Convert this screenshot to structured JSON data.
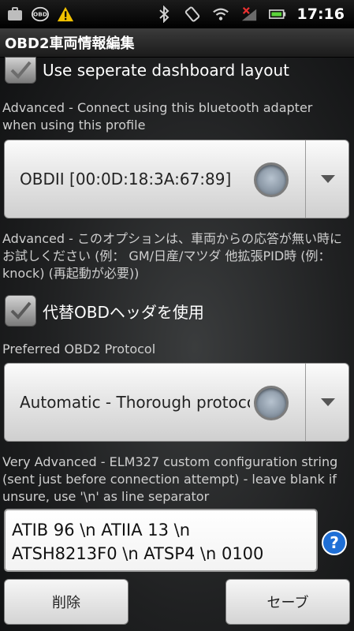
{
  "status_bar": {
    "icons": [
      "briefcase-icon",
      "obd-icon",
      "warning-icon",
      "bluetooth-icon",
      "rotate-icon",
      "wifi-icon",
      "no-signal-icon",
      "battery-icon"
    ],
    "time": "17:16"
  },
  "title": "OBD2車両情報編集",
  "prefs": {
    "separate_layout": {
      "label": "Use seperate dashboard layout",
      "checked": true
    },
    "bt_adapter": {
      "description": "Advanced - Connect using this bluetooth adapter when using this profile",
      "value": "OBDII [00:0D:18:3A:67:89]"
    },
    "alt_header": {
      "description": "Advanced - このオプションは、車両からの応答が無い時にお試しください (例： GM/日産/マツダ 他拡張PID時 (例： knock) (再起動が必要))",
      "label": "代替OBDヘッダを使用",
      "checked": true
    },
    "protocol": {
      "description": "Preferred OBD2 Protocol",
      "value": "Automatic - Thorough protocol"
    },
    "elm_config": {
      "description": "Very Advanced - ELM327 custom configuration string (sent just before connection attempt) - leave blank if unsure, use '\\n' as line separator",
      "line1": "ATIB 96 \\n ATIIA 13 \\n",
      "line2": "ATSH8213F0 \\n ATSP4 \\n 0100"
    }
  },
  "buttons": {
    "delete": "削除",
    "save": "セーブ"
  },
  "colors": {
    "help_blue": "#1f6fd6",
    "warning_yellow": "#f2c200",
    "battery_green": "#5bd33a"
  }
}
